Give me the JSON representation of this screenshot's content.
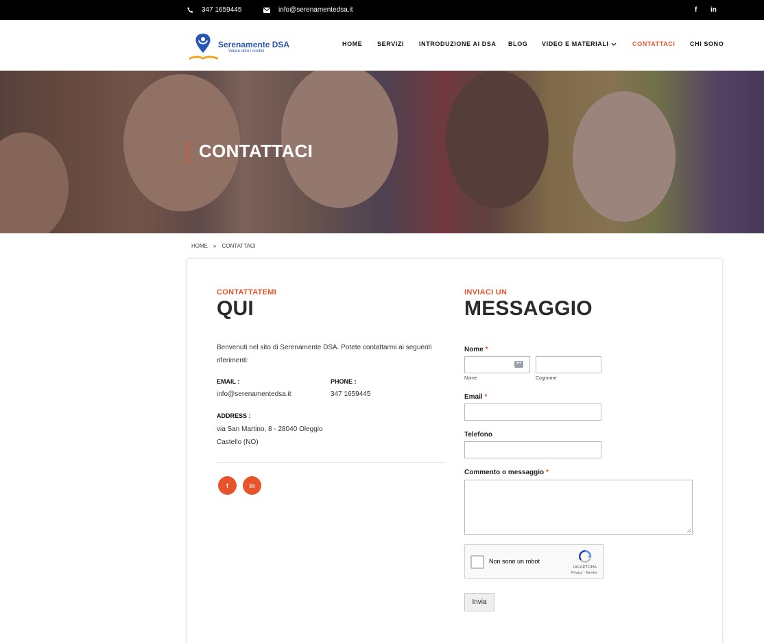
{
  "topbar": {
    "phone": "347 1659445",
    "email": "info@serenamentedsa.it",
    "facebook_label": "f",
    "linkedin_label": "in"
  },
  "logo": {
    "brand": "Serenamente DSA",
    "tagline": "Volare oltre i confini"
  },
  "nav": {
    "items": [
      {
        "label": "HOME"
      },
      {
        "label": "SERVIZI"
      },
      {
        "label": "INTRODUZIONE AI DSA"
      },
      {
        "label": "BLOG"
      },
      {
        "label": "VIDEO E MATERIALI"
      },
      {
        "label": "CONTATTACI"
      },
      {
        "label": "CHI SONO"
      }
    ],
    "active": "CONTATTACI"
  },
  "hero": {
    "title": "CONTATTACI"
  },
  "breadcrumb": {
    "home": "HOME",
    "separator": "»",
    "current": "CONTATTACI"
  },
  "contact": {
    "kicker": "CONTATTATEMI",
    "title": "QUI",
    "intro": "Benvenuti nel sito di Serenamente DSA. Potete contattarmi ai seguenti riferimenti:",
    "email_label": "EMAIL :",
    "email_value": "info@serenamentedsa.it",
    "phone_label": "PHONE :",
    "phone_value": "347 1659445",
    "address_label": "ADDRESS :",
    "address_line1": "via San Martino, 8 - 28040 Oleggio",
    "address_line2": "Castello (NO)",
    "social_facebook": "f",
    "social_linkedin": "in"
  },
  "form": {
    "kicker": "INVIACI UN",
    "title": "MESSAGGIO",
    "required_mark": "*",
    "name_label": "Nome",
    "first_sub": "Nome",
    "last_sub": "Cognome",
    "email_label": "Email",
    "phone_label": "Telefono",
    "message_label": "Commento o messaggio",
    "captcha_text": "Non sono un robot",
    "captcha_brand": "reCAPTCHA",
    "captcha_links": "Privacy - Termini",
    "submit": "Invia"
  },
  "colors": {
    "accent": "#e8532b",
    "topbar": "#000000",
    "brand": "#2a56b5"
  }
}
